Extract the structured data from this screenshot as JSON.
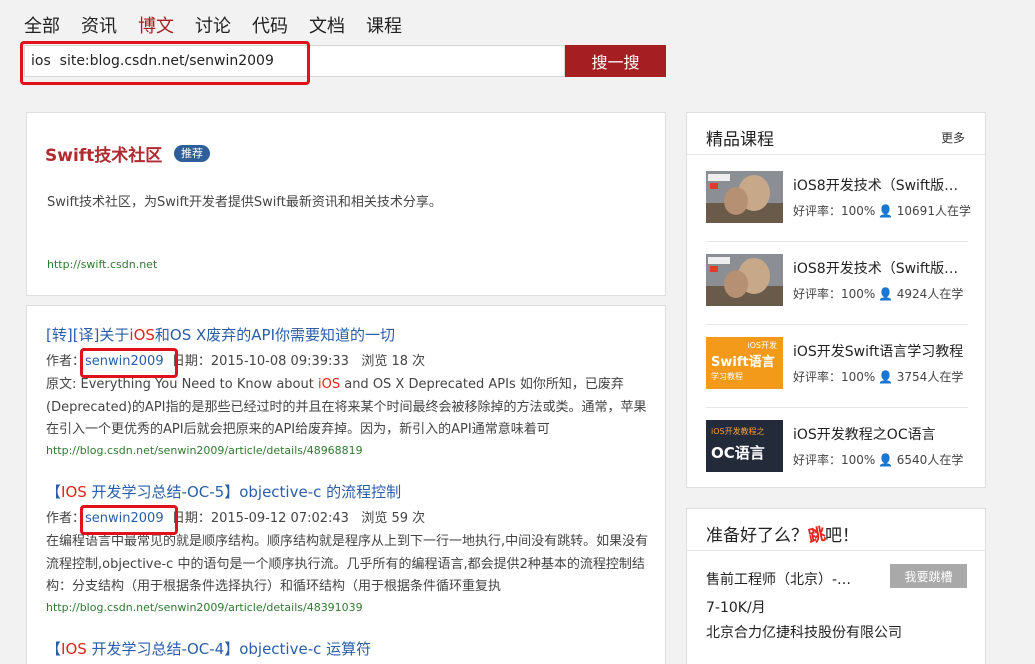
{
  "nav": [
    "全部",
    "资讯",
    "博文",
    "讨论",
    "代码",
    "文档",
    "课程"
  ],
  "nav_active_index": 2,
  "search": {
    "query": "ios  site:blog.csdn.net/senwin2009",
    "button": "搜一搜"
  },
  "recommend": {
    "title": "Swift技术社区",
    "tag": "推荐",
    "description": "Swift技术社区，为Swift开发者提供Swift最新资讯和相关技术分享。",
    "url": "http://swift.csdn.net"
  },
  "results": [
    {
      "title_pre": "[转][译]关于",
      "title_kw": "iOS",
      "title_post": "和OS X废弃的API你需要知道的一切",
      "author_label": "作者：",
      "author": "senwin2009",
      "date": "日期：2015-10-08 09:39:33",
      "views": "浏览 18 次",
      "body_pre": "原文: Everything You Need to Know about ",
      "body_kw": "iOS",
      "body_post": " and OS X Deprecated APIs 如你所知，已废弃(Deprecated)的API指的是那些已经过时的并且在将来某个时间最终会被移除掉的方法或类。通常，苹果在引入一个更优秀的API后就会把原来的API给废弃掉。因为，新引入的API通常意味着可",
      "url": "http://blog.csdn.net/senwin2009/article/details/48968819"
    },
    {
      "title_pre": "【",
      "title_kw": "IOS",
      "title_post": " 开发学习总结-OC-5】objective-c 的流程控制",
      "author_label": "作者：",
      "author": "senwin2009",
      "date": "日期：2015-09-12 07:02:43",
      "views": "浏览 59 次",
      "body_pre": "在编程语言中最常见的就是顺序结构。顺序结构就是程序从上到下一行一地执行,中间没有跳转。如果没有流程控制,objective-c 中的语句是一个顺序执行流。几乎所有的编程语言,都会提供2种基本的流程控制结构：分支结构（用于根据条件选择执行）和循环结构（用于根据条件循环重复执",
      "body_kw": "",
      "body_post": "",
      "url": "http://blog.csdn.net/senwin2009/article/details/48391039"
    },
    {
      "title_pre": "【",
      "title_kw": "IOS",
      "title_post": " 开发学习总结-OC-4】objective-c 运算符"
    }
  ],
  "courses_panel": {
    "title": "精品课程",
    "more": "更多",
    "items": [
      {
        "title": "iOS8开发技术（Swift版…",
        "rate": "好评率：100%",
        "users": "10691人在学",
        "thumb": "swift-photo"
      },
      {
        "title": "iOS8开发技术（Swift版…",
        "rate": "好评率：100%",
        "users": "4924人在学",
        "thumb": "swift-photo"
      },
      {
        "title": "iOS开发Swift语言学习教程",
        "rate": "好评率：100%",
        "users": "3754人在学",
        "thumb": "swift-orange",
        "thumb_small": "iOS开发",
        "thumb_big": "Swift语言",
        "thumb_sub": "学习教程"
      },
      {
        "title": "iOS开发教程之OC语言",
        "rate": "好评率：100%",
        "users": "6540人在学",
        "thumb": "oc-dark",
        "thumb_small": "iOS开发教程之",
        "thumb_big": "OC语言"
      }
    ]
  },
  "jobs_panel": {
    "title_pre": "准备好了么？",
    "title_mark": "跳",
    "title_post": "吧！",
    "job_title": "售前工程师（北京）-…",
    "apply": "我要跳槽",
    "salary": "7-10K/月",
    "company": "北京合力亿捷科技股份有限公司"
  },
  "colors": {
    "brand": "#a51e22",
    "link": "#2a5ea8",
    "keyword": "#e2231a",
    "url": "#2f7a2f",
    "highlight": "#e0111b"
  }
}
